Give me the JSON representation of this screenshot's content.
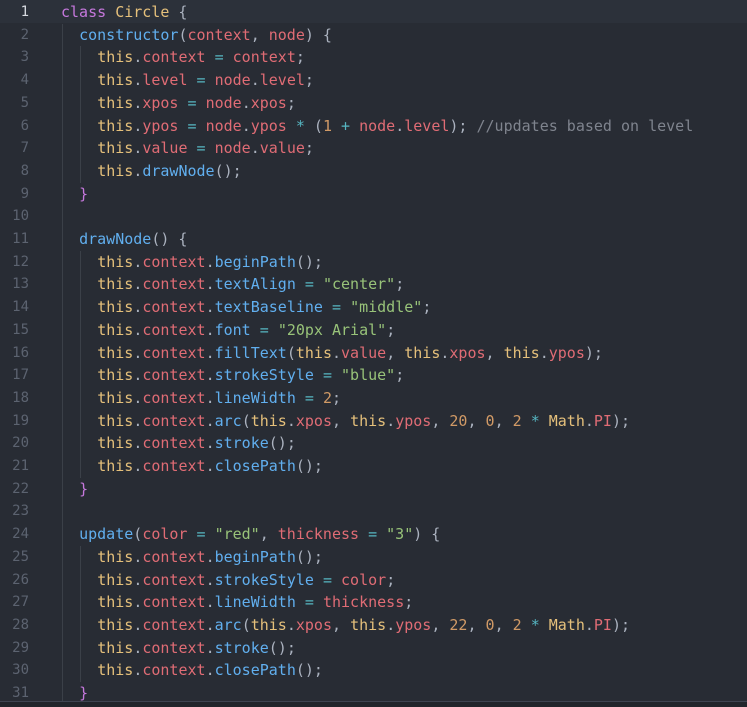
{
  "editor": {
    "theme_colors": {
      "background": "#282c34",
      "keyword": "#c678dd",
      "class": "#e5c07b",
      "function": "#61afef",
      "property": "#e06c75",
      "string": "#98c379",
      "number": "#d19a66",
      "operator": "#56b6c2",
      "comment": "#7f848e",
      "plain": "#abb2bf"
    },
    "active_line": 1,
    "line_numbers": [
      "1",
      "2",
      "3",
      "4",
      "5",
      "6",
      "7",
      "8",
      "9",
      "10",
      "11",
      "12",
      "13",
      "14",
      "15",
      "16",
      "17",
      "18",
      "19",
      "20",
      "21",
      "22",
      "23",
      "24",
      "25",
      "26",
      "27",
      "28",
      "29",
      "30",
      "31"
    ],
    "lines": [
      {
        "indent": 0,
        "tokens": [
          [
            "kw",
            "class"
          ],
          [
            "pl",
            " "
          ],
          [
            "cls",
            "Circle"
          ],
          [
            "pl",
            " {"
          ]
        ]
      },
      {
        "indent": 1,
        "tokens": [
          [
            "fn",
            "constructor"
          ],
          [
            "pl",
            "("
          ],
          [
            "prop",
            "context"
          ],
          [
            "pl",
            ", "
          ],
          [
            "prop",
            "node"
          ],
          [
            "pl",
            ") {"
          ]
        ]
      },
      {
        "indent": 2,
        "tokens": [
          [
            "this",
            "this"
          ],
          [
            "pl",
            "."
          ],
          [
            "prop",
            "context"
          ],
          [
            "pl",
            " "
          ],
          [
            "op",
            "="
          ],
          [
            "pl",
            " "
          ],
          [
            "prop",
            "context"
          ],
          [
            "pl",
            ";"
          ]
        ]
      },
      {
        "indent": 2,
        "tokens": [
          [
            "this",
            "this"
          ],
          [
            "pl",
            "."
          ],
          [
            "prop",
            "level"
          ],
          [
            "pl",
            " "
          ],
          [
            "op",
            "="
          ],
          [
            "pl",
            " "
          ],
          [
            "prop",
            "node"
          ],
          [
            "pl",
            "."
          ],
          [
            "prop",
            "level"
          ],
          [
            "pl",
            ";"
          ]
        ]
      },
      {
        "indent": 2,
        "tokens": [
          [
            "this",
            "this"
          ],
          [
            "pl",
            "."
          ],
          [
            "prop",
            "xpos"
          ],
          [
            "pl",
            " "
          ],
          [
            "op",
            "="
          ],
          [
            "pl",
            " "
          ],
          [
            "prop",
            "node"
          ],
          [
            "pl",
            "."
          ],
          [
            "prop",
            "xpos"
          ],
          [
            "pl",
            ";"
          ]
        ]
      },
      {
        "indent": 2,
        "tokens": [
          [
            "this",
            "this"
          ],
          [
            "pl",
            "."
          ],
          [
            "prop",
            "ypos"
          ],
          [
            "pl",
            " "
          ],
          [
            "op",
            "="
          ],
          [
            "pl",
            " "
          ],
          [
            "prop",
            "node"
          ],
          [
            "pl",
            "."
          ],
          [
            "prop",
            "ypos"
          ],
          [
            "pl",
            " "
          ],
          [
            "op",
            "*"
          ],
          [
            "pl",
            " ("
          ],
          [
            "num",
            "1"
          ],
          [
            "pl",
            " "
          ],
          [
            "op",
            "+"
          ],
          [
            "pl",
            " "
          ],
          [
            "prop",
            "node"
          ],
          [
            "pl",
            "."
          ],
          [
            "prop",
            "level"
          ],
          [
            "pl",
            "); "
          ],
          [
            "cm",
            "//updates based on level"
          ]
        ]
      },
      {
        "indent": 2,
        "tokens": [
          [
            "this",
            "this"
          ],
          [
            "pl",
            "."
          ],
          [
            "prop",
            "value"
          ],
          [
            "pl",
            " "
          ],
          [
            "op",
            "="
          ],
          [
            "pl",
            " "
          ],
          [
            "prop",
            "node"
          ],
          [
            "pl",
            "."
          ],
          [
            "prop",
            "value"
          ],
          [
            "pl",
            ";"
          ]
        ]
      },
      {
        "indent": 2,
        "tokens": [
          [
            "this",
            "this"
          ],
          [
            "pl",
            "."
          ],
          [
            "fn",
            "drawNode"
          ],
          [
            "pl",
            "();"
          ]
        ]
      },
      {
        "indent": 1,
        "tokens": [
          [
            "kw",
            "}"
          ]
        ]
      },
      {
        "indent": 0,
        "tokens": []
      },
      {
        "indent": 1,
        "tokens": [
          [
            "fn",
            "drawNode"
          ],
          [
            "pl",
            "() {"
          ]
        ]
      },
      {
        "indent": 2,
        "tokens": [
          [
            "this",
            "this"
          ],
          [
            "pl",
            "."
          ],
          [
            "prop",
            "context"
          ],
          [
            "pl",
            "."
          ],
          [
            "fn",
            "beginPath"
          ],
          [
            "pl",
            "();"
          ]
        ]
      },
      {
        "indent": 2,
        "tokens": [
          [
            "this",
            "this"
          ],
          [
            "pl",
            "."
          ],
          [
            "prop",
            "context"
          ],
          [
            "pl",
            "."
          ],
          [
            "fn",
            "textAlign"
          ],
          [
            "pl",
            " "
          ],
          [
            "op",
            "="
          ],
          [
            "pl",
            " "
          ],
          [
            "str",
            "\"center\""
          ],
          [
            "pl",
            ";"
          ]
        ]
      },
      {
        "indent": 2,
        "tokens": [
          [
            "this",
            "this"
          ],
          [
            "pl",
            "."
          ],
          [
            "prop",
            "context"
          ],
          [
            "pl",
            "."
          ],
          [
            "fn",
            "textBaseline"
          ],
          [
            "pl",
            " "
          ],
          [
            "op",
            "="
          ],
          [
            "pl",
            " "
          ],
          [
            "str",
            "\"middle\""
          ],
          [
            "pl",
            ";"
          ]
        ]
      },
      {
        "indent": 2,
        "tokens": [
          [
            "this",
            "this"
          ],
          [
            "pl",
            "."
          ],
          [
            "prop",
            "context"
          ],
          [
            "pl",
            "."
          ],
          [
            "fn",
            "font"
          ],
          [
            "pl",
            " "
          ],
          [
            "op",
            "="
          ],
          [
            "pl",
            " "
          ],
          [
            "str",
            "\"20px Arial\""
          ],
          [
            "pl",
            ";"
          ]
        ]
      },
      {
        "indent": 2,
        "tokens": [
          [
            "this",
            "this"
          ],
          [
            "pl",
            "."
          ],
          [
            "prop",
            "context"
          ],
          [
            "pl",
            "."
          ],
          [
            "fn",
            "fillText"
          ],
          [
            "pl",
            "("
          ],
          [
            "this",
            "this"
          ],
          [
            "pl",
            "."
          ],
          [
            "prop",
            "value"
          ],
          [
            "pl",
            ", "
          ],
          [
            "this",
            "this"
          ],
          [
            "pl",
            "."
          ],
          [
            "prop",
            "xpos"
          ],
          [
            "pl",
            ", "
          ],
          [
            "this",
            "this"
          ],
          [
            "pl",
            "."
          ],
          [
            "prop",
            "ypos"
          ],
          [
            "pl",
            ");"
          ]
        ]
      },
      {
        "indent": 2,
        "tokens": [
          [
            "this",
            "this"
          ],
          [
            "pl",
            "."
          ],
          [
            "prop",
            "context"
          ],
          [
            "pl",
            "."
          ],
          [
            "fn",
            "strokeStyle"
          ],
          [
            "pl",
            " "
          ],
          [
            "op",
            "="
          ],
          [
            "pl",
            " "
          ],
          [
            "str",
            "\"blue\""
          ],
          [
            "pl",
            ";"
          ]
        ]
      },
      {
        "indent": 2,
        "tokens": [
          [
            "this",
            "this"
          ],
          [
            "pl",
            "."
          ],
          [
            "prop",
            "context"
          ],
          [
            "pl",
            "."
          ],
          [
            "fn",
            "lineWidth"
          ],
          [
            "pl",
            " "
          ],
          [
            "op",
            "="
          ],
          [
            "pl",
            " "
          ],
          [
            "num",
            "2"
          ],
          [
            "pl",
            ";"
          ]
        ]
      },
      {
        "indent": 2,
        "tokens": [
          [
            "this",
            "this"
          ],
          [
            "pl",
            "."
          ],
          [
            "prop",
            "context"
          ],
          [
            "pl",
            "."
          ],
          [
            "fn",
            "arc"
          ],
          [
            "pl",
            "("
          ],
          [
            "this",
            "this"
          ],
          [
            "pl",
            "."
          ],
          [
            "prop",
            "xpos"
          ],
          [
            "pl",
            ", "
          ],
          [
            "this",
            "this"
          ],
          [
            "pl",
            "."
          ],
          [
            "prop",
            "ypos"
          ],
          [
            "pl",
            ", "
          ],
          [
            "num",
            "20"
          ],
          [
            "pl",
            ", "
          ],
          [
            "num",
            "0"
          ],
          [
            "pl",
            ", "
          ],
          [
            "num",
            "2"
          ],
          [
            "pl",
            " "
          ],
          [
            "op",
            "*"
          ],
          [
            "pl",
            " "
          ],
          [
            "cls",
            "Math"
          ],
          [
            "pl",
            "."
          ],
          [
            "prop",
            "PI"
          ],
          [
            "pl",
            ");"
          ]
        ]
      },
      {
        "indent": 2,
        "tokens": [
          [
            "this",
            "this"
          ],
          [
            "pl",
            "."
          ],
          [
            "prop",
            "context"
          ],
          [
            "pl",
            "."
          ],
          [
            "fn",
            "stroke"
          ],
          [
            "pl",
            "();"
          ]
        ]
      },
      {
        "indent": 2,
        "tokens": [
          [
            "this",
            "this"
          ],
          [
            "pl",
            "."
          ],
          [
            "prop",
            "context"
          ],
          [
            "pl",
            "."
          ],
          [
            "fn",
            "closePath"
          ],
          [
            "pl",
            "();"
          ]
        ]
      },
      {
        "indent": 1,
        "tokens": [
          [
            "kw",
            "}"
          ]
        ]
      },
      {
        "indent": 0,
        "tokens": []
      },
      {
        "indent": 1,
        "tokens": [
          [
            "fn",
            "update"
          ],
          [
            "pl",
            "("
          ],
          [
            "prop",
            "color"
          ],
          [
            "pl",
            " "
          ],
          [
            "op",
            "="
          ],
          [
            "pl",
            " "
          ],
          [
            "str",
            "\"red\""
          ],
          [
            "pl",
            ", "
          ],
          [
            "prop",
            "thickness"
          ],
          [
            "pl",
            " "
          ],
          [
            "op",
            "="
          ],
          [
            "pl",
            " "
          ],
          [
            "str",
            "\"3\""
          ],
          [
            "pl",
            ") {"
          ]
        ]
      },
      {
        "indent": 2,
        "tokens": [
          [
            "this",
            "this"
          ],
          [
            "pl",
            "."
          ],
          [
            "prop",
            "context"
          ],
          [
            "pl",
            "."
          ],
          [
            "fn",
            "beginPath"
          ],
          [
            "pl",
            "();"
          ]
        ]
      },
      {
        "indent": 2,
        "tokens": [
          [
            "this",
            "this"
          ],
          [
            "pl",
            "."
          ],
          [
            "prop",
            "context"
          ],
          [
            "pl",
            "."
          ],
          [
            "fn",
            "strokeStyle"
          ],
          [
            "pl",
            " "
          ],
          [
            "op",
            "="
          ],
          [
            "pl",
            " "
          ],
          [
            "prop",
            "color"
          ],
          [
            "pl",
            ";"
          ]
        ]
      },
      {
        "indent": 2,
        "tokens": [
          [
            "this",
            "this"
          ],
          [
            "pl",
            "."
          ],
          [
            "prop",
            "context"
          ],
          [
            "pl",
            "."
          ],
          [
            "fn",
            "lineWidth"
          ],
          [
            "pl",
            " "
          ],
          [
            "op",
            "="
          ],
          [
            "pl",
            " "
          ],
          [
            "prop",
            "thickness"
          ],
          [
            "pl",
            ";"
          ]
        ]
      },
      {
        "indent": 2,
        "tokens": [
          [
            "this",
            "this"
          ],
          [
            "pl",
            "."
          ],
          [
            "prop",
            "context"
          ],
          [
            "pl",
            "."
          ],
          [
            "fn",
            "arc"
          ],
          [
            "pl",
            "("
          ],
          [
            "this",
            "this"
          ],
          [
            "pl",
            "."
          ],
          [
            "prop",
            "xpos"
          ],
          [
            "pl",
            ", "
          ],
          [
            "this",
            "this"
          ],
          [
            "pl",
            "."
          ],
          [
            "prop",
            "ypos"
          ],
          [
            "pl",
            ", "
          ],
          [
            "num",
            "22"
          ],
          [
            "pl",
            ", "
          ],
          [
            "num",
            "0"
          ],
          [
            "pl",
            ", "
          ],
          [
            "num",
            "2"
          ],
          [
            "pl",
            " "
          ],
          [
            "op",
            "*"
          ],
          [
            "pl",
            " "
          ],
          [
            "cls",
            "Math"
          ],
          [
            "pl",
            "."
          ],
          [
            "prop",
            "PI"
          ],
          [
            "pl",
            ");"
          ]
        ]
      },
      {
        "indent": 2,
        "tokens": [
          [
            "this",
            "this"
          ],
          [
            "pl",
            "."
          ],
          [
            "prop",
            "context"
          ],
          [
            "pl",
            "."
          ],
          [
            "fn",
            "stroke"
          ],
          [
            "pl",
            "();"
          ]
        ]
      },
      {
        "indent": 2,
        "tokens": [
          [
            "this",
            "this"
          ],
          [
            "pl",
            "."
          ],
          [
            "prop",
            "context"
          ],
          [
            "pl",
            "."
          ],
          [
            "fn",
            "closePath"
          ],
          [
            "pl",
            "();"
          ]
        ]
      },
      {
        "indent": 1,
        "tokens": [
          [
            "kw",
            "}"
          ]
        ]
      }
    ]
  }
}
